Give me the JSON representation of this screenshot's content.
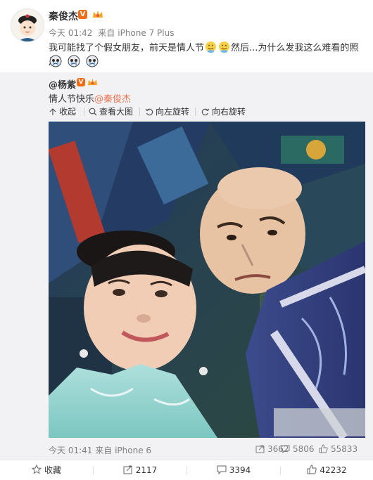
{
  "post": {
    "author": "秦俊杰",
    "time": "今天 01:42",
    "source_prefix": "来自",
    "source": "iPhone 7 Plus",
    "text_part1": "我可能找了个假女朋友，前天是情人节",
    "text_part2": "然后...为什么发我这么难看的照片"
  },
  "repost": {
    "author": "@杨紫",
    "text": "情人节快乐",
    "mention": "@秦俊杰",
    "toolbar": {
      "collapse": "收起",
      "view_large": "查看大图",
      "rotate_left": "向左旋转",
      "rotate_right": "向右旋转"
    },
    "footer": {
      "time": "今天 01:41",
      "source_prefix": "来自",
      "source": "iPhone 6",
      "forwards": "3662",
      "comments": "5806",
      "likes": "55833"
    }
  },
  "actions": {
    "favorite": "收藏",
    "forward": "2117",
    "comment": "3394",
    "like": "42232"
  },
  "colors": {
    "accent": "#eb7350",
    "vip_orange": "#f26a11",
    "meta_gray": "#808080",
    "repost_bg": "#f2f2f5"
  }
}
